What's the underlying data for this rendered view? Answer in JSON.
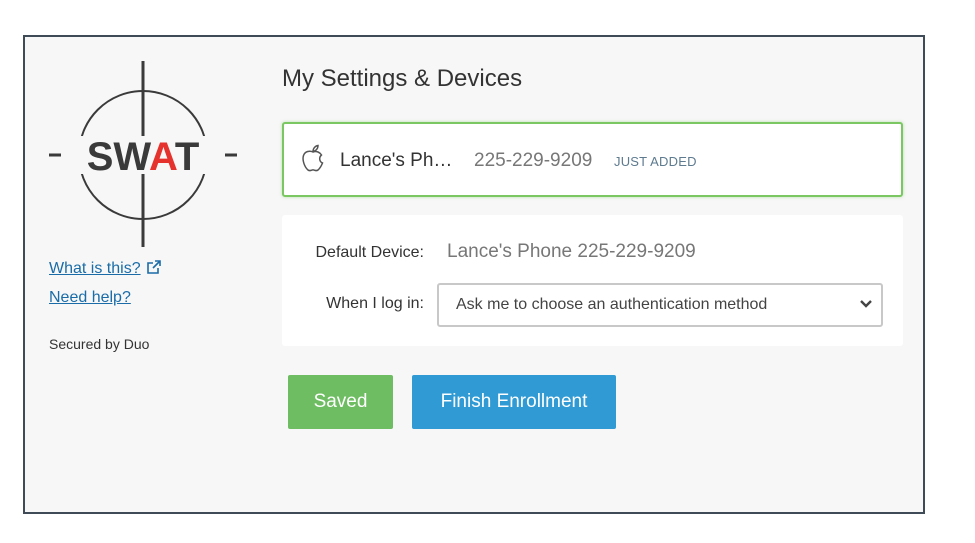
{
  "logo": {
    "text": "SWAT",
    "colors": {
      "dark": "#3a3a3a",
      "accent": "#e5322d"
    }
  },
  "sidebar": {
    "what_is_this": "What is this?",
    "need_help": "Need help?",
    "secured_by": "Secured by Duo"
  },
  "main": {
    "title": "My Settings & Devices",
    "device": {
      "icon": "apple-icon",
      "name": "Lance's Ph…",
      "number": "225-229-9209",
      "badge": "JUST ADDED"
    },
    "settings": {
      "default_device_label": "Default Device:",
      "default_device_value": "Lance's Phone 225-229-9209",
      "login_label": "When I log in:",
      "login_selected": "Ask me to choose an authentication method"
    },
    "buttons": {
      "saved": "Saved",
      "finish": "Finish Enrollment"
    }
  },
  "colors": {
    "saved_button": "#6ebd62",
    "finish_button": "#2f9ad4",
    "card_border_active": "#7bc862",
    "link": "#1a6ca8"
  }
}
